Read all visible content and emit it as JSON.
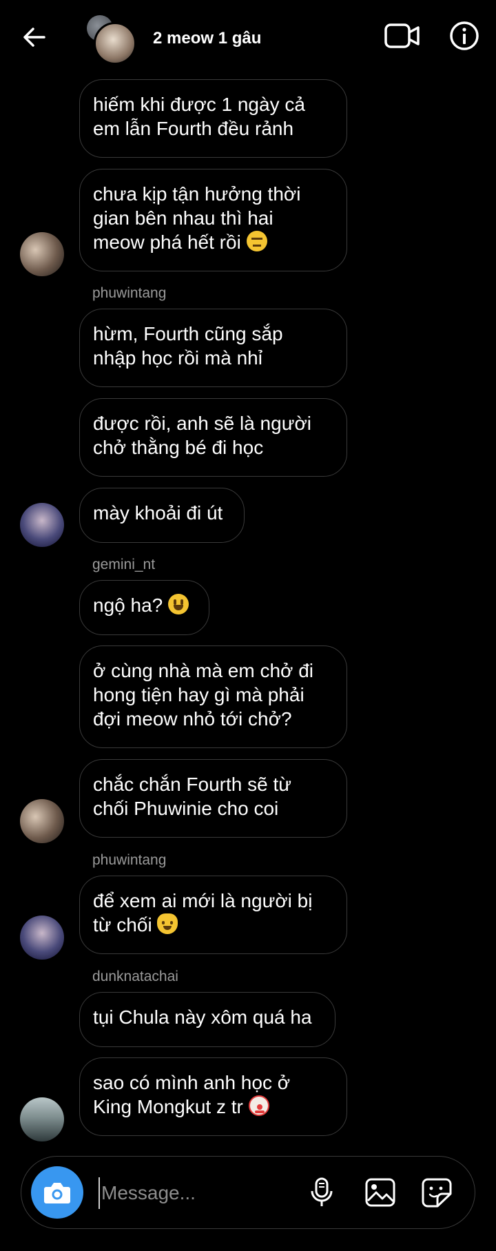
{
  "header": {
    "title": "2 meow 1 gâu",
    "back_icon": "arrow-left-icon",
    "video_icon": "video-camera-icon",
    "info_icon": "info-icon"
  },
  "messages": [
    {
      "text_lines": [
        "hiếm khi được 1 ngày cả",
        "em lẫn Fourth đều rảnh"
      ]
    },
    {
      "text_lines": [
        "chưa kịp tận hưởng thời",
        "gian bên nhau thì hai",
        "meow phá hết rồi"
      ],
      "emoji": "neutral-face"
    },
    {
      "username": "phuwintang"
    },
    {
      "text_lines": [
        "hừm, Fourth cũng sắp",
        "nhập học rồi mà nhỉ"
      ]
    },
    {
      "text_lines": [
        "được rồi, anh sẽ là người",
        "chở thằng bé đi học"
      ]
    },
    {
      "text_lines": [
        "mày khoải đi út"
      ]
    },
    {
      "username": "gemini_nt"
    },
    {
      "text_lines": [
        "ngộ ha?"
      ],
      "emoji": "smiley"
    },
    {
      "text_lines": [
        "ở cùng nhà mà em chở đi",
        "hong tiện hay gì mà phải",
        "đợi meow nhỏ tới chở?"
      ]
    },
    {
      "text_lines": [
        "chắc chắn Fourth sẽ từ",
        "chối Phuwinie cho coi"
      ]
    },
    {
      "username": "phuwintang"
    },
    {
      "text_lines": [
        "để xem ai mới là người bị",
        "từ chối"
      ],
      "emoji": "cat-face"
    },
    {
      "username": "dunknatachai"
    },
    {
      "text_lines": [
        "tụi Chula này xôm quá ha"
      ]
    },
    {
      "text_lines": [
        "sao có mình anh học ở",
        "King Mongkut z tr"
      ],
      "emoji": "clown-face"
    }
  ],
  "composer": {
    "placeholder": "Message...",
    "camera_icon": "camera-icon",
    "mic_icon": "microphone-icon",
    "gallery_icon": "image-icon",
    "sticker_icon": "sticker-icon"
  },
  "colors": {
    "background": "#000000",
    "bubble_border": "#3a3a3a",
    "username": "#9a9a9a",
    "camera_button": "#3897f0"
  }
}
